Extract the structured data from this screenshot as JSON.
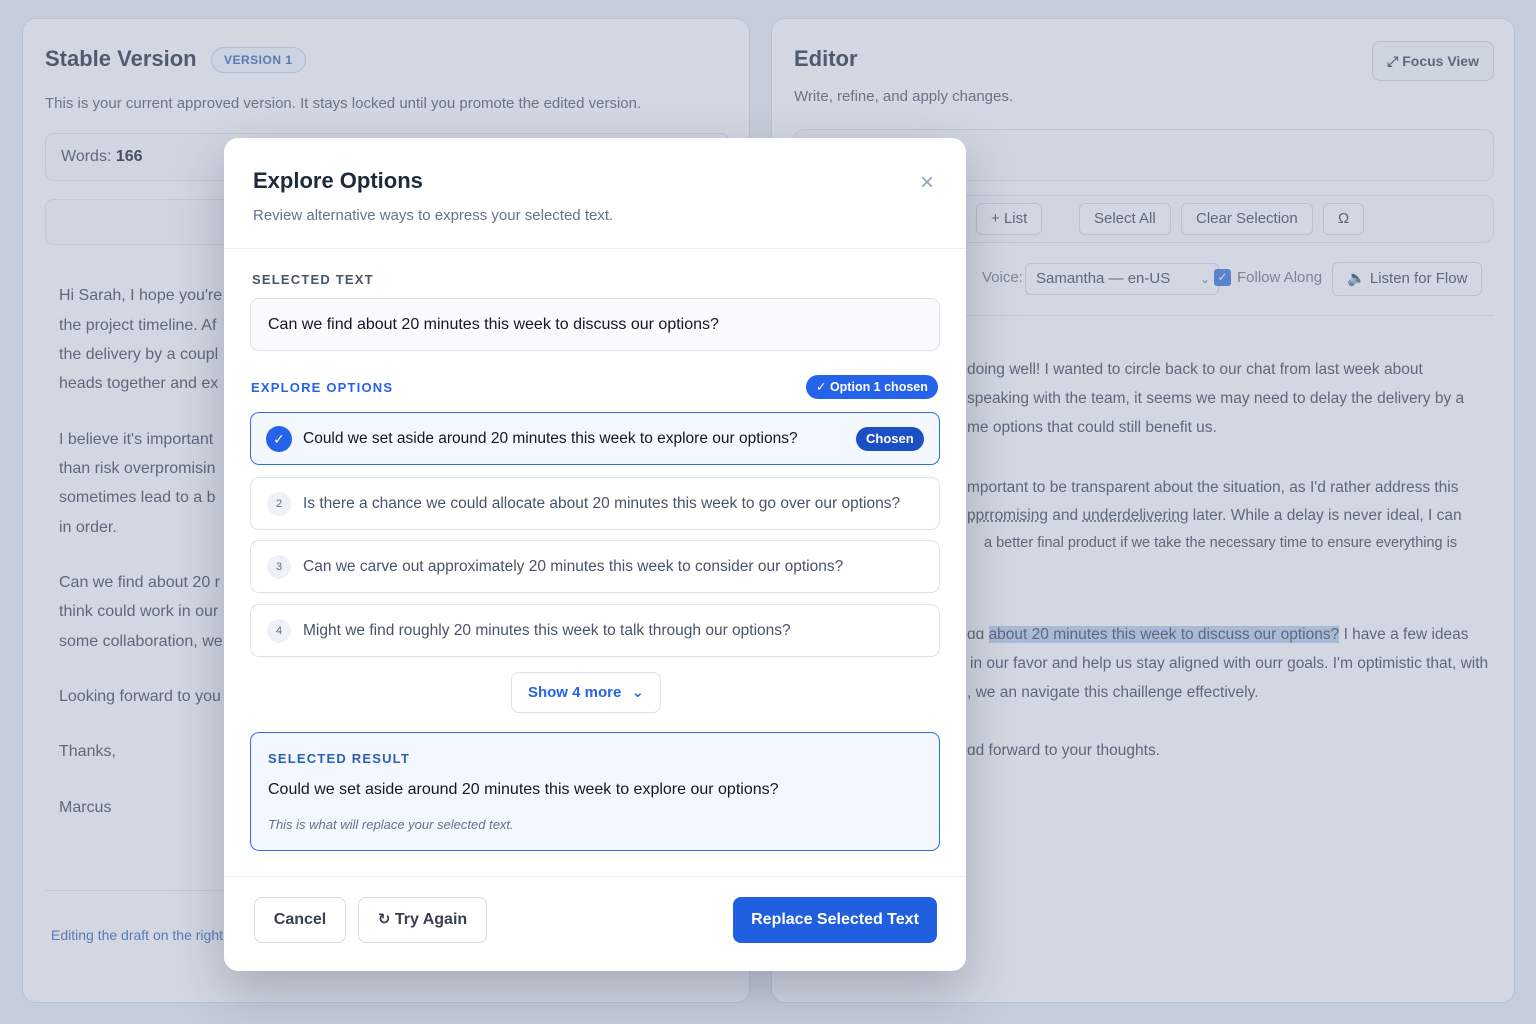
{
  "left_panel": {
    "title": "Stable Version",
    "badge": "VERSION 1",
    "subtitle": "This is your current approved version. It stays locked until you promote the edited version.",
    "words_label": "Words:",
    "words_count": "166",
    "body_lines": [
      "Hi Sarah, I hope you're",
      "the project timeline. Af",
      "the delivery by a coupl",
      "heads together and ex",
      "I believe it's important",
      "than risk overpromisin",
      "sometimes lead to a b",
      "in order.",
      "Can we find about 20 r",
      "think could work in our",
      "some collaboration, we",
      "Looking forward to you",
      "Thanks,",
      "Marcus"
    ],
    "footer": "Editing the draft on the right."
  },
  "right_panel": {
    "title": "Editor",
    "subtitle": "Write, refine, and apply changes.",
    "focus_button": "Focus View",
    "toolbar": {
      "list": "List",
      "select_all": "Select All",
      "clear_selection": "Clear Selection",
      "special_char": "Ω"
    },
    "voice_label": "Voice:",
    "voice_value": "Samantha — en-US",
    "follow_along": "Follow Along",
    "listen_button": "Listen for Flow",
    "body": {
      "l1": "doing well! I wanted to circle back to our chat from last week about",
      "l2": "speaking with the team, it seems we may need to delay the delivery by a",
      "l3": "me options that could still benefit us.",
      "l4": "mportant to be transparent about the situation, as I'd rather address this",
      "l5_a": "pprromising",
      "l5_b": "and",
      "l5_c": "underdelivering",
      "l5_d": "later. While a delay is never ideal, I can",
      "l6": "a better final product if we take the necessary time to ensure everything is",
      "l7_pre": "ɑɑ",
      "l7_hl": "about 20 minutes this week to discuss our options?",
      "l7_post": "I have a few ideas",
      "l8": "in our favor and help us stay aligned with ourr goals. I'm optimistic that, with",
      "l9": ", we an navigate this chaillenge effectively.",
      "l10": "ɑd forward to your thoughts."
    }
  },
  "modal": {
    "title": "Explore Options",
    "subtitle": "Review alternative ways to express your selected text.",
    "selected_text_label": "SELECTED TEXT",
    "selected_text": "Can we find about 20 minutes this week to discuss our options?",
    "explore_label": "EXPLORE OPTIONS",
    "chosen_pill": "✓ Option 1 chosen",
    "options": [
      {
        "number": "1",
        "text": "Could we set aside around 20 minutes this week to explore our options?",
        "tag": "Chosen"
      },
      {
        "number": "2",
        "text": "Is there a chance we could allocate about 20 minutes this week to go over our options?"
      },
      {
        "number": "3",
        "text": "Can we carve out approximately 20 minutes this week to consider our options?"
      },
      {
        "number": "4",
        "text": "Might we find roughly 20 minutes this week to talk through our options?"
      }
    ],
    "show_more": "Show 4 more",
    "result_label": "SELECTED RESULT",
    "result_text": "Could we set aside around 20 minutes this week to explore our options?",
    "result_note": "This is what will replace your selected text.",
    "cancel": "Cancel",
    "try_again": "Try Again",
    "replace": "Replace Selected Text"
  },
  "colors": {
    "accent": "#2563eb",
    "accent_dark": "#1d4fc4",
    "overlay": "#94a0b8"
  }
}
